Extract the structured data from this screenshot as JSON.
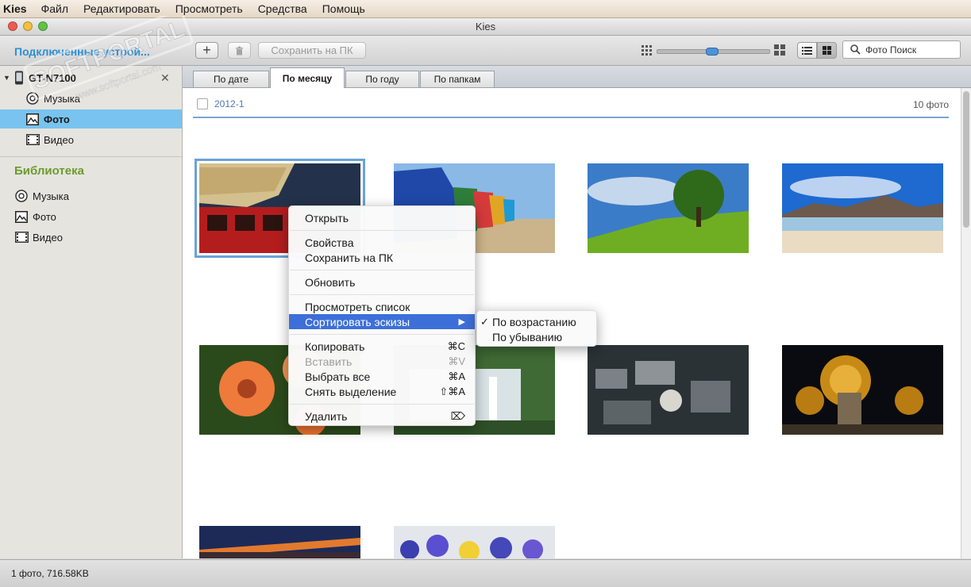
{
  "menubar": {
    "app": "Kies",
    "items": [
      "Файл",
      "Редактировать",
      "Просмотреть",
      "Средства",
      "Помощь"
    ]
  },
  "window": {
    "title": "Kies"
  },
  "toolbar": {
    "devices_header": "Подключенные устрой...",
    "add_label": "+",
    "save_to_pc": "Сохранить на ПК",
    "search_placeholder": "Фото Поиск",
    "zoom_level": 0.48
  },
  "sidebar": {
    "device_name": "GT-N7100",
    "device_items": [
      "Музыка",
      "Фото",
      "Видео"
    ],
    "library_header": "Библиотека",
    "library_items": [
      "Музыка",
      "Фото",
      "Видео"
    ]
  },
  "tabs": [
    "По дате",
    "По месяцу",
    "По году",
    "По папкам"
  ],
  "group": {
    "label": "2012-1",
    "count": "10 фото"
  },
  "context_menu": {
    "items": [
      {
        "label": "Открыть"
      },
      {
        "label": "Свойства"
      },
      {
        "label": "Сохранить на ПК"
      },
      {
        "label": "Обновить"
      },
      {
        "label": "Просмотреть список"
      },
      {
        "label": "Сортировать эскизы"
      },
      {
        "label": "Копировать",
        "shortcut": "⌘C"
      },
      {
        "label": "Вставить",
        "shortcut": "⌘V"
      },
      {
        "label": "Выбрать все",
        "shortcut": "⌘A"
      },
      {
        "label": "Снять выделение",
        "shortcut": "⇧⌘A"
      },
      {
        "label": "Удалить",
        "shortcut": "⌦"
      }
    ],
    "submenu": {
      "arrow": "▶",
      "check": "✓",
      "items": [
        "По возрастанию",
        "По убыванию"
      ]
    }
  },
  "status": {
    "text": "1 фото, 716.58KB"
  },
  "watermark": {
    "text": "SOFTPORTAL",
    "url": "www.softportal.com"
  },
  "colors": {
    "sidebar_selection": "#78c3ef",
    "menu_highlight": "#3d6fd9",
    "devices_header": "#2c8fd6",
    "library_header": "#6a9c2d"
  }
}
